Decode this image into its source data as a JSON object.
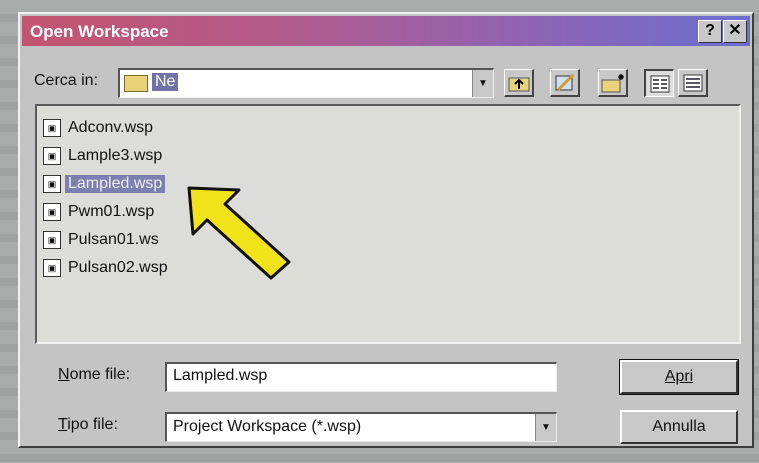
{
  "window": {
    "title": "Open Workspace",
    "help_label": "?",
    "close_label": "✕"
  },
  "lookin": {
    "label": "Cerca in:",
    "value": "Ne"
  },
  "toolbar": {
    "icons": [
      "up-folder-icon",
      "desktop-icon",
      "new-folder-icon",
      "list-view-icon",
      "details-view-icon"
    ]
  },
  "files": [
    {
      "name": "Adconv.wsp",
      "selected": false
    },
    {
      "name": "Lample3.wsp",
      "selected": false
    },
    {
      "name": "Lampled.wsp",
      "selected": true
    },
    {
      "name": "Pwm01.wsp",
      "selected": false
    },
    {
      "name": "Pulsan01.ws",
      "selected": false
    },
    {
      "name": "Pulsan02.wsp",
      "selected": false
    }
  ],
  "filename": {
    "label_first": "N",
    "label_rest": "ome file:",
    "value": "Lampled.wsp"
  },
  "filetype": {
    "label_first": "T",
    "label_rest": "ipo file:",
    "value": "Project Workspace (*.wsp)"
  },
  "buttons": {
    "open_label": "Apri",
    "cancel_label": "Annulla"
  },
  "colors": {
    "title_gradient_start": "#c2556f",
    "title_gradient_end": "#6b6fd0",
    "selection": "#7b80b0",
    "arrow": "#f2e21a"
  }
}
